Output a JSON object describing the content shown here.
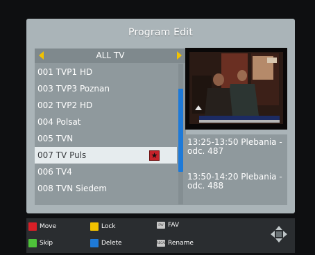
{
  "screen": {
    "title": "Program Edit",
    "category": "ALL TV",
    "channels": [
      {
        "label": "001 TVP1 HD",
        "selected": false,
        "locked": false
      },
      {
        "label": "003 TVP3 Poznan",
        "selected": false,
        "locked": false
      },
      {
        "label": "002 TVP2 HD",
        "selected": false,
        "locked": false
      },
      {
        "label": "004 Polsat",
        "selected": false,
        "locked": false
      },
      {
        "label": "005 TVN",
        "selected": false,
        "locked": false
      },
      {
        "label": "007 TV Puls",
        "selected": true,
        "locked": true
      },
      {
        "label": "006 TV4",
        "selected": false,
        "locked": false
      },
      {
        "label": "008 TVN Siedem",
        "selected": false,
        "locked": false
      }
    ],
    "epg": [
      {
        "line1": "13:25-13:50  Plebania -",
        "line2": "odc. 487"
      },
      {
        "line1": "13:50-14:20  Plebania -",
        "line2": "odc. 488"
      }
    ],
    "lock_badge_glyph": "★"
  },
  "legend": {
    "move": "Move",
    "skip": "Skip",
    "lock": "Lock",
    "delete": "Delete",
    "fav": "FAV",
    "rename": "Rename",
    "fav_key": "FAV",
    "rename_key": "RECALL"
  },
  "colors": {
    "red": "#d81f27",
    "green": "#4ec33a",
    "yellow": "#f2c200",
    "blue": "#1e7ad8",
    "selection": "#e6ecee",
    "panel": "#aab4b8"
  }
}
